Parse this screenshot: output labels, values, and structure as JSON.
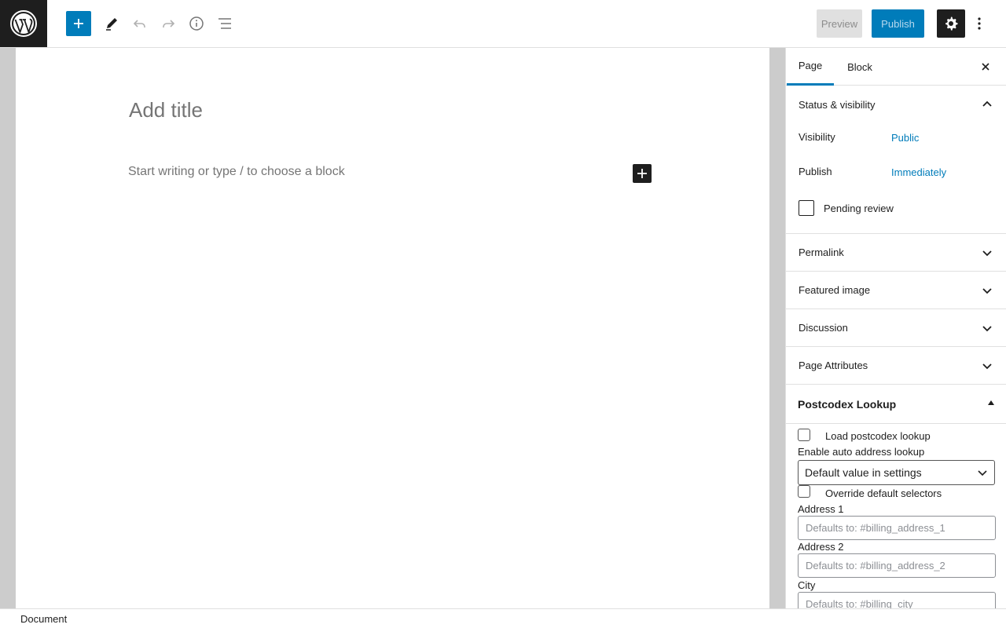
{
  "toolbar": {
    "preview_label": "Preview",
    "publish_label": "Publish"
  },
  "editor": {
    "title_placeholder": "Add title",
    "block_placeholder": "Start writing or type / to choose a block"
  },
  "sidebar": {
    "tabs": [
      {
        "label": "Page",
        "active": true
      },
      {
        "label": "Block",
        "active": false
      }
    ],
    "status_visibility": {
      "title": "Status & visibility",
      "expanded": true,
      "visibility_label": "Visibility",
      "visibility_value": "Public",
      "publish_label": "Publish",
      "publish_value": "Immediately",
      "pending_label": "Pending review"
    },
    "panels": [
      {
        "title": "Permalink"
      },
      {
        "title": "Featured image"
      },
      {
        "title": "Discussion"
      },
      {
        "title": "Page Attributes"
      }
    ],
    "postcodex": {
      "title": "Postcodex Lookup",
      "load_label": "Load postcodex lookup",
      "auto_label": "Enable auto address lookup",
      "auto_select_value": "Default value in settings",
      "override_label": "Override default selectors",
      "fields": [
        {
          "label": "Address 1",
          "placeholder": "Defaults to: #billing_address_1"
        },
        {
          "label": "Address 2",
          "placeholder": "Defaults to: #billing_address_2"
        },
        {
          "label": "City",
          "placeholder": "Defaults to: #billing_city"
        }
      ]
    }
  },
  "statusbar": {
    "breadcrumb": "Document"
  },
  "colors": {
    "accent": "#007cba",
    "dark": "#1e1e1e"
  }
}
